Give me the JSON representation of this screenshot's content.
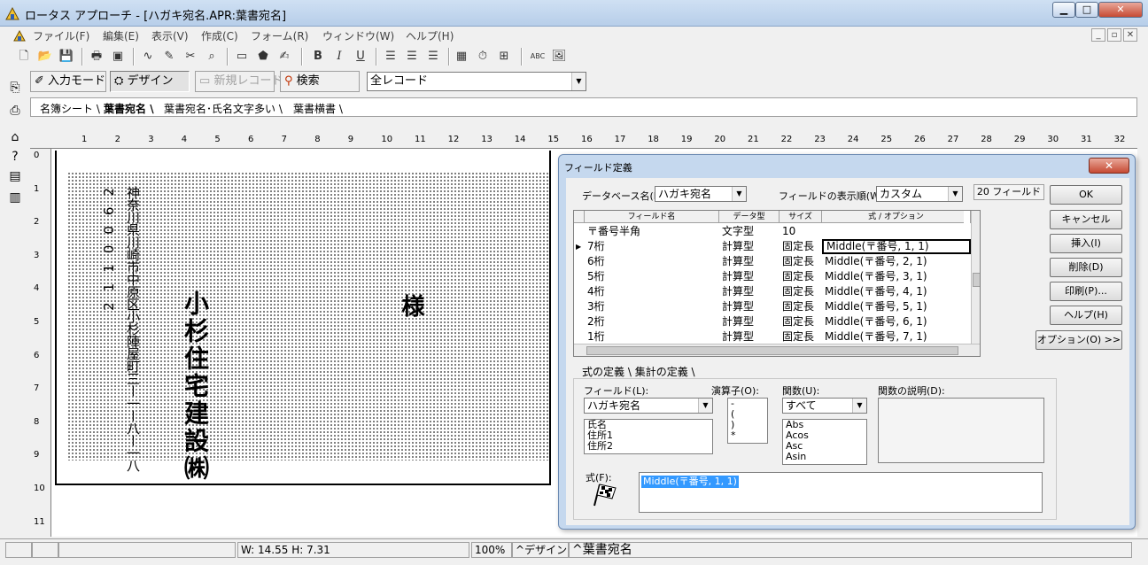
{
  "window": {
    "title": "ロータス アプローチ - [ハガキ宛名.APR:葉書宛名]"
  },
  "menu": [
    "ファイル(F)",
    "編集(E)",
    "表示(V)",
    "作成(C)",
    "フォーム(R)",
    "ウィンドウ(W)",
    "ヘルプ(H)"
  ],
  "modebar": {
    "input_mode": "入力モード",
    "design": "デザイン",
    "new_record": "新規レコード",
    "search": "検索",
    "record_filter": "全レコード"
  },
  "tabs": [
    "名簿シート",
    "葉書宛名",
    "葉書宛名･氏名文字多い",
    "葉書横書"
  ],
  "ruler": {
    "top": [
      "1",
      "2",
      "3",
      "4",
      "5",
      "6",
      "7",
      "8",
      "9",
      "10",
      "11",
      "12",
      "13",
      "14",
      "15",
      "16",
      "17",
      "18",
      "19",
      "20",
      "21",
      "22",
      "23",
      "24",
      "25",
      "26",
      "27",
      "28",
      "29",
      "30",
      "31",
      "32"
    ],
    "left": [
      "0",
      "1",
      "2",
      "3",
      "4",
      "5",
      "6",
      "7",
      "8",
      "9",
      "10",
      "11"
    ]
  },
  "postcard": {
    "postal_code": "2110062",
    "address": "神奈川県川崎市中原区小杉陣屋町三ー一ー八ー一八",
    "recipient": "小杉住宅建設㈱",
    "honorific": "様"
  },
  "status": {
    "size": "W: 14.55  H: 7.31",
    "zoom": "100%",
    "mode": "デザイン",
    "form": "葉書宛名"
  },
  "dialog": {
    "title": "フィールド定義",
    "database_label": "データベース名(B):",
    "database_value": "ハガキ宛名",
    "display_order_label": "フィールドの表示順(W):",
    "display_order_value": "カスタム",
    "field_count": "20 フィールド",
    "columns": [
      "フィールド名",
      "データ型",
      "サイズ",
      "式 / オプション"
    ],
    "rows": [
      {
        "name": "〒番号半角",
        "type": "文字型",
        "size": "10",
        "formula": ""
      },
      {
        "name": "7桁",
        "type": "計算型",
        "size": "固定長",
        "formula": "Middle(〒番号, 1, 1)"
      },
      {
        "name": "6桁",
        "type": "計算型",
        "size": "固定長",
        "formula": "Middle(〒番号, 2, 1)"
      },
      {
        "name": "5桁",
        "type": "計算型",
        "size": "固定長",
        "formula": "Middle(〒番号, 3, 1)"
      },
      {
        "name": "4桁",
        "type": "計算型",
        "size": "固定長",
        "formula": "Middle(〒番号, 4, 1)"
      },
      {
        "name": "3桁",
        "type": "計算型",
        "size": "固定長",
        "formula": "Middle(〒番号, 5, 1)"
      },
      {
        "name": "2桁",
        "type": "計算型",
        "size": "固定長",
        "formula": "Middle(〒番号, 6, 1)"
      },
      {
        "name": "1桁",
        "type": "計算型",
        "size": "固定長",
        "formula": "Middle(〒番号, 7, 1)"
      }
    ],
    "buttons": {
      "ok": "OK",
      "cancel": "キャンセル",
      "insert": "挿入(I)",
      "delete": "削除(D)",
      "print": "印刷(P)...",
      "help": "ヘルプ(H)",
      "options": "オプション(O) >>"
    },
    "subtabs": [
      "式の定義",
      "集計の定義"
    ],
    "field_label": "フィールド(L):",
    "field_value": "ハガキ宛名",
    "field_list": [
      "氏名",
      "住所1",
      "住所2"
    ],
    "operator_label": "演算子(O):",
    "operator_list": [
      "-",
      "(",
      ")",
      "*"
    ],
    "function_label": "関数(U):",
    "function_value": "すべて",
    "function_list": [
      "Abs",
      "Acos",
      "Asc",
      "Asin"
    ],
    "function_desc_label": "関数の説明(D):",
    "formula_label": "式(F):",
    "formula_value": "Middle(〒番号, 1, 1)"
  }
}
